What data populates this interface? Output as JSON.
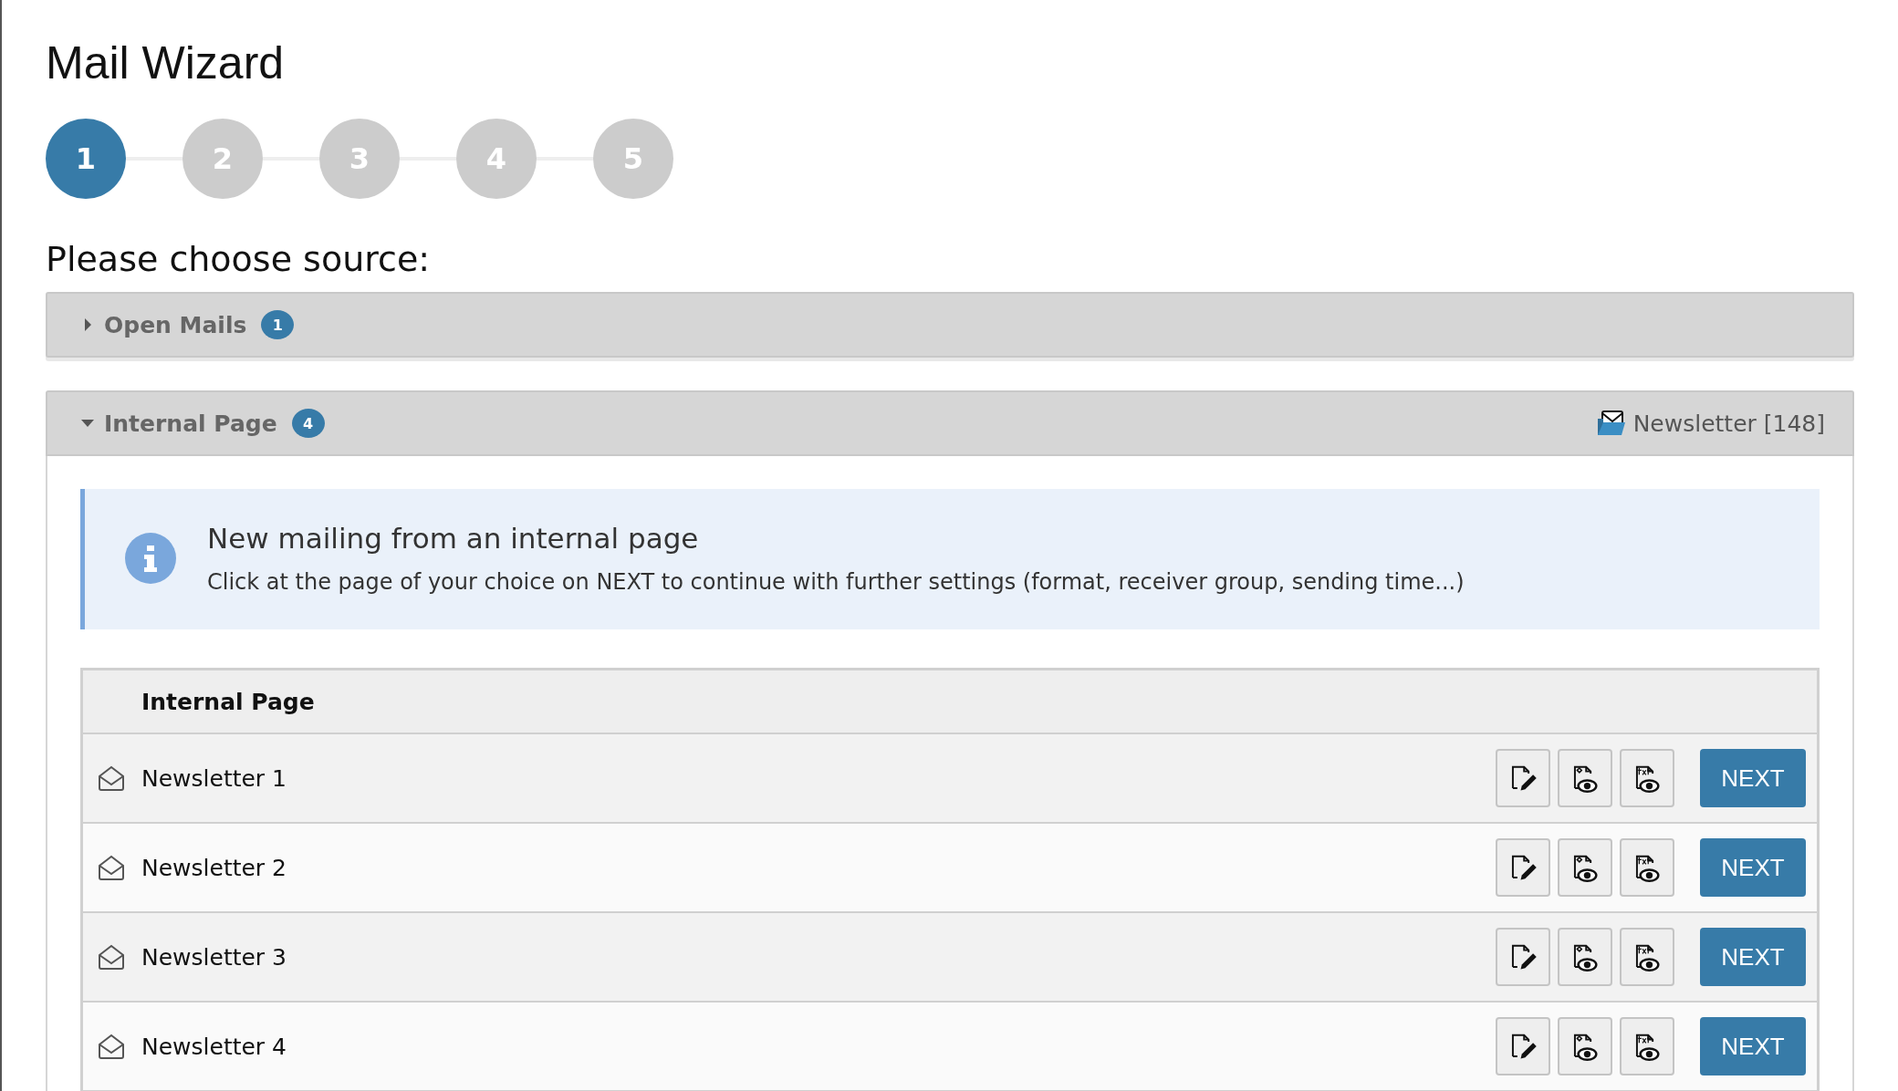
{
  "title": "Mail Wizard",
  "steps": [
    {
      "label": "1",
      "selected": true
    },
    {
      "label": "2",
      "selected": false
    },
    {
      "label": "3",
      "selected": false
    },
    {
      "label": "4",
      "selected": false
    },
    {
      "label": "5",
      "selected": false
    }
  ],
  "prompt": "Please choose source:",
  "sections": [
    {
      "title": "Open Mails",
      "badge": "1",
      "expanded": false
    },
    {
      "title": "Internal Page",
      "badge": "4",
      "expanded": true,
      "list_label": "Newsletter [148]",
      "info": {
        "heading": "New mailing from an internal page",
        "text": "Click at the page of your choice on NEXT to continue with further settings (format, receiver group, sending time...)"
      },
      "table": {
        "columns": [
          "Internal Page"
        ],
        "rows": [
          {
            "name": "Newsletter 1",
            "action": "NEXT"
          },
          {
            "name": "Newsletter 2",
            "action": "NEXT"
          },
          {
            "name": "Newsletter 3",
            "action": "NEXT"
          },
          {
            "name": "Newsletter 4",
            "action": "NEXT"
          }
        ]
      }
    }
  ]
}
